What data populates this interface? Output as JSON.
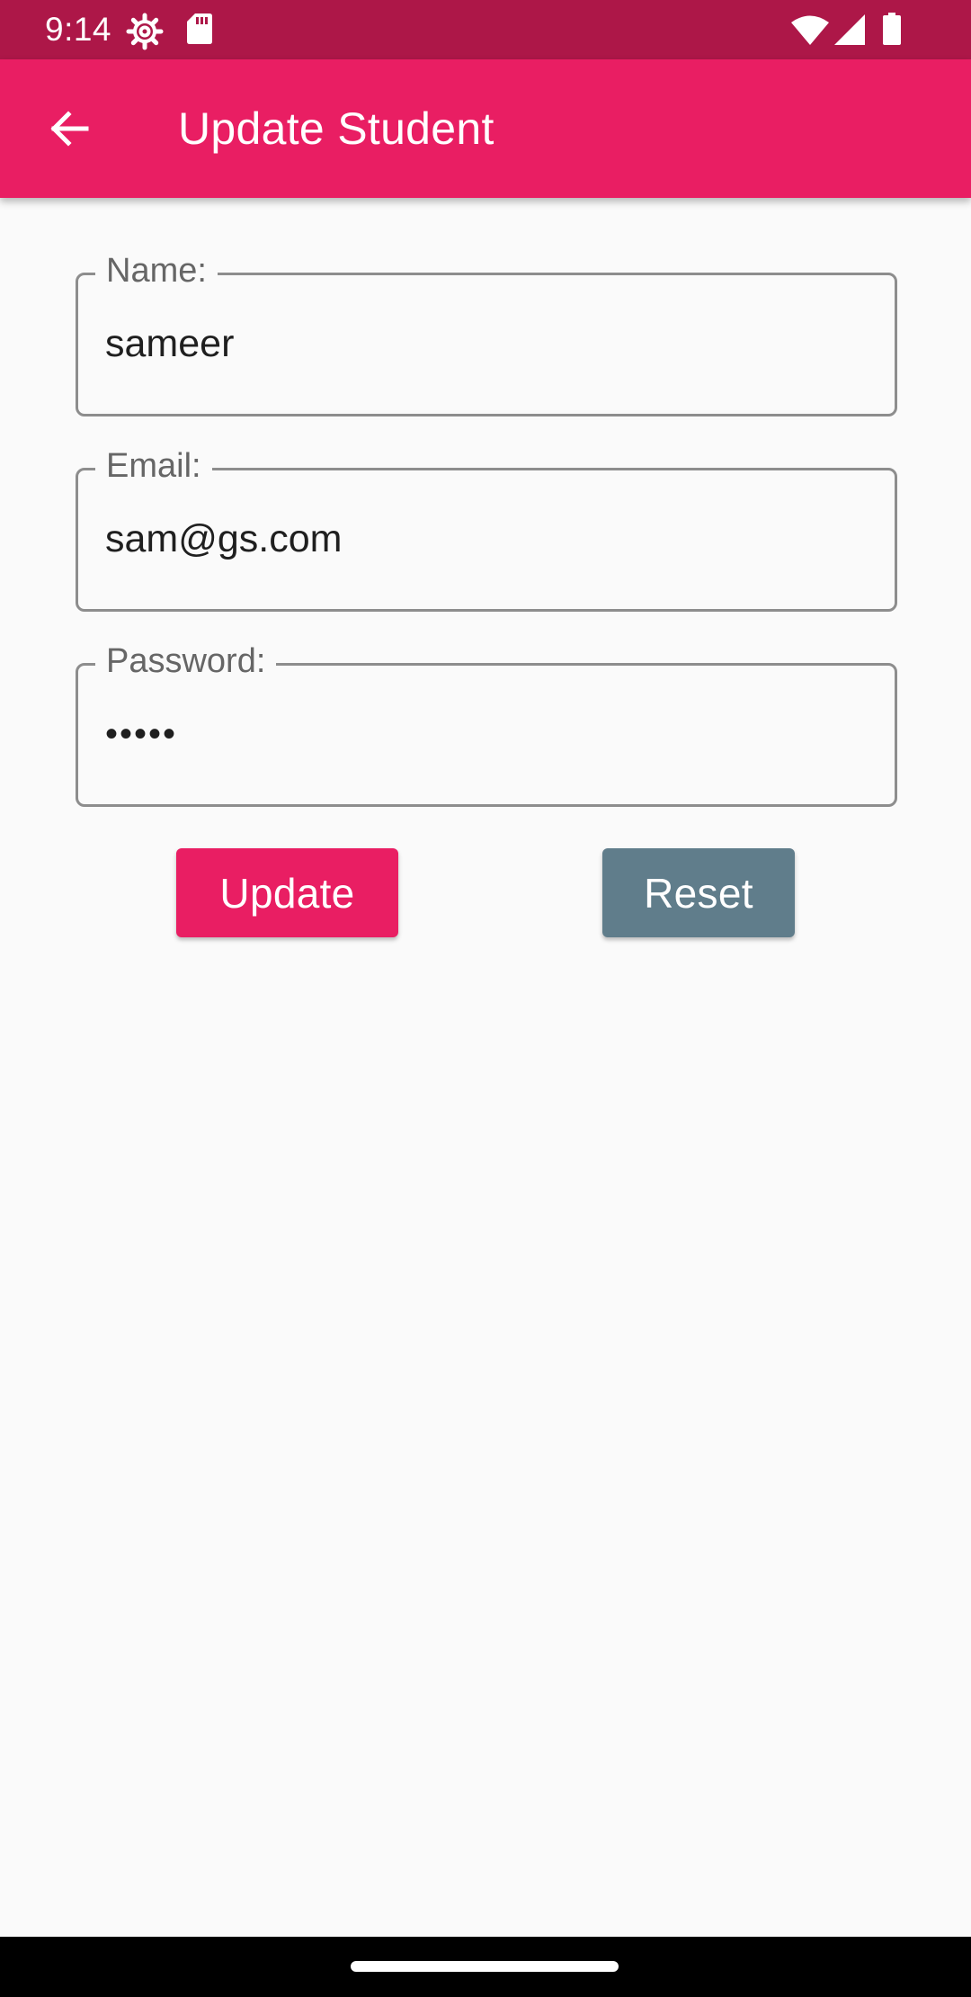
{
  "status_bar": {
    "time": "9:14",
    "icons": [
      "settings-gear-icon",
      "sd-card-icon",
      "wifi-icon",
      "cellular-signal-icon",
      "battery-icon"
    ]
  },
  "app_bar": {
    "back_icon": "arrow-back-icon",
    "title": "Update Student"
  },
  "form": {
    "name": {
      "label": "Name:",
      "value": "sameer"
    },
    "email": {
      "label": "Email:",
      "value": "sam@gs.com"
    },
    "password": {
      "label": "Password:",
      "value": "•••••"
    }
  },
  "buttons": {
    "update_label": "Update",
    "reset_label": "Reset"
  },
  "colors": {
    "status_bar": "#ad1748",
    "primary": "#e91e63",
    "secondary_button": "#607d8b",
    "background": "#fafafa"
  }
}
